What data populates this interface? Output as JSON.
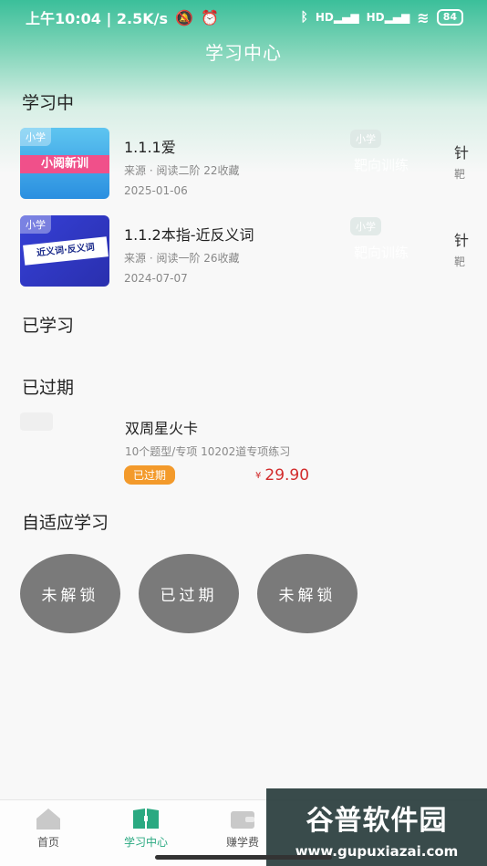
{
  "status_bar": {
    "time_speed": "上午10:04 | 2.5K/s",
    "battery": "84"
  },
  "header": {
    "title": "学习中心"
  },
  "sections": {
    "learning": "学习中",
    "learned": "已学习",
    "expired": "已过期",
    "adaptive": "自适应学习"
  },
  "learning_courses": [
    {
      "thumb_grade": "小学",
      "thumb_banner": "小阅新训",
      "title": "1.1.1爱",
      "meta": "来源 · 阅读二阶   22收藏",
      "date": "2025-01-06",
      "ghost_tag": "小学",
      "ghost_text": "靶向训练",
      "edge_title": "针",
      "edge_meta": "靶"
    },
    {
      "thumb_grade": "小学",
      "thumb_banner": "近义词·反义词",
      "title": "1.1.2本指-近反义词",
      "meta": "来源 · 阅读一阶   26收藏",
      "date": "2024-07-07",
      "ghost_tag": "小学",
      "ghost_text": "靶向训练",
      "edge_title": "针",
      "edge_meta": "靶"
    }
  ],
  "expired_item": {
    "title": "双周星火卡",
    "meta": "10个题型/专项   10202道专项练习",
    "badge": "已过期",
    "currency": "¥",
    "price": "29.90"
  },
  "adaptive_buttons": [
    "未解锁",
    "已过期",
    "未解锁"
  ],
  "tab_bar": {
    "home": "首页",
    "study": "学习中心",
    "earn": "赚学费"
  },
  "watermark": {
    "main": "谷普软件园",
    "url": "www.gupuxiazai.com"
  },
  "colors": {
    "accent": "#2aa981",
    "price": "#d22c2c",
    "badge": "#f39a2b",
    "circle": "#7a7a7a"
  }
}
